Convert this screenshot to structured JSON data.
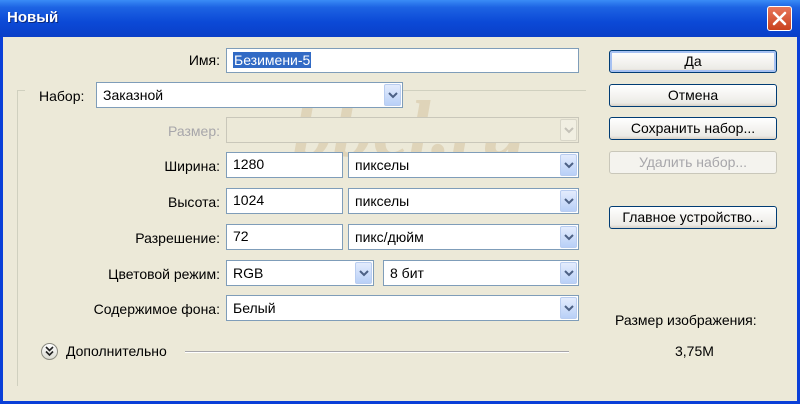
{
  "window": {
    "title": "Новый"
  },
  "watermark": "bbel.ru",
  "form": {
    "name_label": "Имя:",
    "name_value": "Безимени-5",
    "preset_label": "Набор:",
    "preset_value": "Заказной",
    "size_label": "Размер:",
    "size_value": "",
    "width_label": "Ширина:",
    "width_value": "1280",
    "width_unit": "пикселы",
    "height_label": "Высота:",
    "height_value": "1024",
    "height_unit": "пикселы",
    "resolution_label": "Разрешение:",
    "resolution_value": "72",
    "resolution_unit": "пикс/дюйм",
    "color_mode_label": "Цветовой режим:",
    "color_mode_value": "RGB",
    "bit_depth_value": "8 бит",
    "background_label": "Содержимое фона:",
    "background_value": "Белый",
    "advanced_label": "Дополнительно"
  },
  "buttons": {
    "ok": "Да",
    "cancel": "Отмена",
    "save_preset": "Сохранить набор...",
    "delete_preset": "Удалить набор...",
    "device_central": "Главное устройство..."
  },
  "image_size": {
    "label": "Размер изображения:",
    "value": "3,75M"
  },
  "icons": {
    "close": "close-icon",
    "dropdown": "chevron-down-icon",
    "advanced": "double-chevron-down-icon"
  }
}
